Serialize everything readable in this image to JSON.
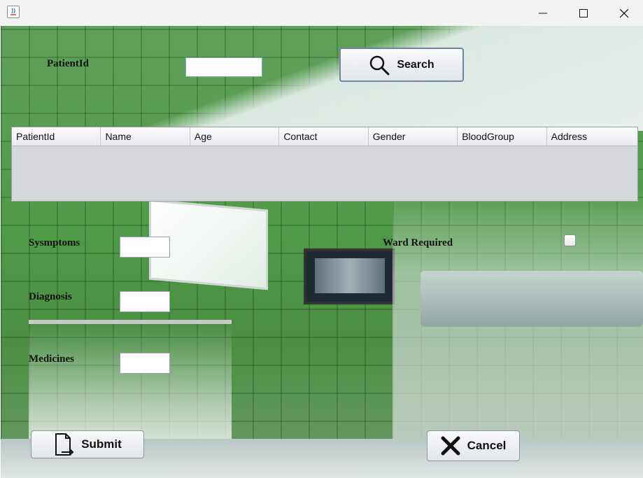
{
  "titlebar": {
    "icons": {
      "app": "java-app-icon",
      "minimize": "minimize-icon",
      "maximize": "maximize-icon",
      "close": "close-icon"
    }
  },
  "form": {
    "patient_id_label": "PatientId",
    "patient_id_value": "",
    "search_label": "Search",
    "symptoms_label": "Sysmptoms",
    "symptoms_value": "",
    "diagnosis_label": "Diagnosis",
    "diagnosis_value": "",
    "medicines_label": "Medicines",
    "medicines_value": "",
    "ward_required_label": "Ward Required",
    "ward_required_checked": false,
    "submit_label": "Submit",
    "cancel_label": "Cancel"
  },
  "table": {
    "columns": [
      "PatientId",
      "Name",
      "Age",
      "Contact",
      "Gender",
      "BloodGroup",
      "Address"
    ],
    "rows": []
  },
  "colors": {
    "button_border": "#6f86a3",
    "grid_body": "#d6d8de",
    "wall_green": "#4f9a47"
  }
}
